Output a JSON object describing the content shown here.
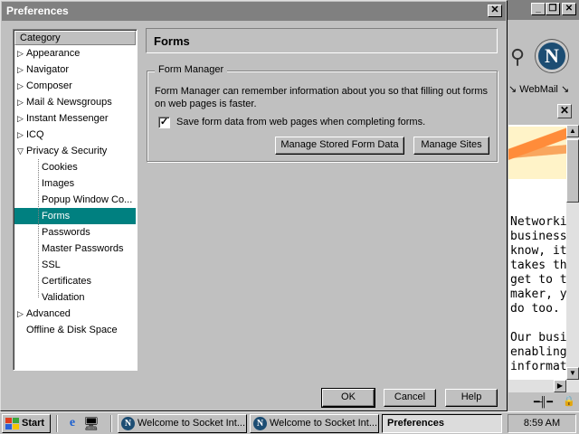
{
  "dialog": {
    "title": "Preferences",
    "close_glyph": "✕"
  },
  "category": {
    "header": "Category",
    "items": [
      {
        "label": "Appearance",
        "state": "collapsed"
      },
      {
        "label": "Navigator",
        "state": "collapsed"
      },
      {
        "label": "Composer",
        "state": "collapsed"
      },
      {
        "label": "Mail & Newsgroups",
        "state": "collapsed"
      },
      {
        "label": "Instant Messenger",
        "state": "collapsed"
      },
      {
        "label": "ICQ",
        "state": "collapsed"
      },
      {
        "label": "Privacy & Security",
        "state": "expanded"
      },
      {
        "label": "Cookies",
        "state": "child"
      },
      {
        "label": "Images",
        "state": "child"
      },
      {
        "label": "Popup Window Co...",
        "state": "child"
      },
      {
        "label": "Forms",
        "state": "child-selected"
      },
      {
        "label": "Passwords",
        "state": "child"
      },
      {
        "label": "Master Passwords",
        "state": "child"
      },
      {
        "label": "SSL",
        "state": "child"
      },
      {
        "label": "Certificates",
        "state": "child"
      },
      {
        "label": "Validation",
        "state": "child"
      },
      {
        "label": "Advanced",
        "state": "collapsed"
      },
      {
        "label": "Offline & Disk Space",
        "state": "leaf"
      }
    ]
  },
  "panel": {
    "title": "Forms",
    "group_label": "Form Manager",
    "description": "Form Manager can remember information about you so that filling out forms on web pages is faster.",
    "checkbox": {
      "label": "Save form data from web pages when completing forms.",
      "checked": true
    },
    "manage_data_button": "Manage Stored Form Data",
    "manage_sites_button": "Manage Sites"
  },
  "footer": {
    "ok": "OK",
    "cancel": "Cancel",
    "help": "Help"
  },
  "browser": {
    "nav_label": "WebMail",
    "logo_letter": "N",
    "article_lines": [
      "Networkin",
      "business.",
      "know, it's",
      "takes the",
      "get to th",
      "maker, yo",
      "do too.",
      "",
      "Our busin",
      "enabling ",
      "informatio"
    ]
  },
  "taskbar": {
    "start_label": "Start",
    "tasks": [
      "Welcome to Socket Int...",
      "Welcome to Socket Int...",
      "Preferences"
    ],
    "clock": "8:59 AM"
  },
  "colors": {
    "selection": "#008080",
    "title_inactive": "#808080",
    "face": "#c0c0c0"
  }
}
